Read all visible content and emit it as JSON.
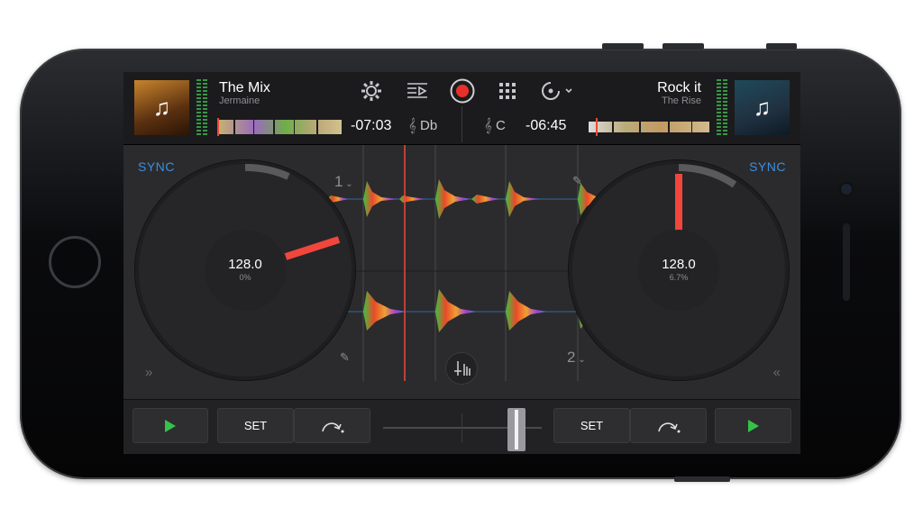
{
  "deck_left": {
    "title": "The Mix",
    "artist": "Jermaine",
    "time": "-07:03",
    "key": "Db",
    "sync_label": "SYNC",
    "bpm": "128.0",
    "pitch": "0%",
    "deck_number": "1",
    "set_label": "SET"
  },
  "deck_right": {
    "title": "Rock it",
    "artist": "The Rise",
    "time": "-06:45",
    "key": "C",
    "sync_label": "SYNC",
    "bpm": "128.0",
    "pitch": "6.7%",
    "deck_number": "2",
    "set_label": "SET"
  },
  "colors": {
    "accent_blue": "#3a8fe0",
    "record_red": "#e8302a",
    "platter_marker": "#f2463c",
    "play_green": "#35c24a"
  },
  "icons": {
    "settings": "gear-icon",
    "effects": "playlist-icon",
    "record": "record-icon",
    "pads": "grid-icon",
    "source": "vinyl-dropdown-icon",
    "edit": "pencil-icon",
    "mixer": "mixer-icon"
  }
}
